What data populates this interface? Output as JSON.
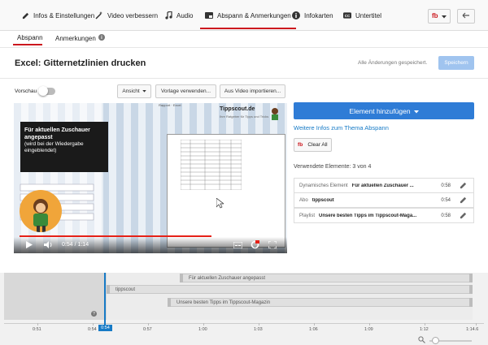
{
  "tabs": [
    {
      "label": "Infos & Einstellungen",
      "icon": "pencil-icon"
    },
    {
      "label": "Video verbessern",
      "icon": "magic-wand-icon"
    },
    {
      "label": "Audio",
      "icon": "music-note-icon"
    },
    {
      "label": "Abspann & Anmerkungen",
      "icon": "endscreen-icon",
      "active": true
    },
    {
      "label": "Infokarten",
      "icon": "info-icon"
    },
    {
      "label": "Untertitel",
      "icon": "captions-icon"
    }
  ],
  "subtabs": {
    "abspann": "Abspann",
    "anmerkungen": "Anmerkungen"
  },
  "page": {
    "title": "Excel: Gitternetzlinien drucken",
    "saved_status": "Alle Änderungen gespeichert.",
    "save_label": "Speichern"
  },
  "toolbar": {
    "preview_label": "Vorschau",
    "view_label": "Ansicht",
    "template_label": "Vorlage verwenden...",
    "import_label": "Aus Video importieren..."
  },
  "video": {
    "brand": "Tippscout.de",
    "brand_sub": "Ihre Ratgeber für Tipps und Tricks",
    "doc_header": "Rapport  ·  Excel",
    "card_title": "Für aktuellen Zuschauer angepasst",
    "card_subtitle": "(wird bei der Wiedergabe eingeblendet)",
    "time": "0:54 / 1:14",
    "progress": 0.73
  },
  "sidebar": {
    "add_label": "Element hinzufügen",
    "more_link": "Weitere Infos zum Thema Abspann",
    "clear_label": "Clear All",
    "used_label": "Verwendete Elemente: 3 von 4",
    "elements": [
      {
        "type": "Dynamisches Element",
        "name": "Für aktuellen Zuschauer ...",
        "duration": "0:58"
      },
      {
        "type": "Abo",
        "name": "tippscout",
        "duration": "0:54"
      },
      {
        "type": "Playlist",
        "name": "Unsere besten Tipps im Tippscout-Maga...",
        "duration": "0:58"
      }
    ]
  },
  "timeline": {
    "tracks": [
      {
        "label": "Für aktuellen Zuschauer angepasst"
      },
      {
        "label": "tippscout"
      },
      {
        "label": "Unsere besten Tipps im Tippscout-Magazin"
      }
    ],
    "playhead": "0:54",
    "ticks": [
      "0:51",
      "0:54",
      "0:57",
      "1:00",
      "1:03",
      "1:06",
      "1:09",
      "1:12",
      "1:14.6"
    ]
  },
  "colors": {
    "accent": "#cc181e",
    "blue": "#2f7cd6",
    "link": "#167ac6"
  }
}
